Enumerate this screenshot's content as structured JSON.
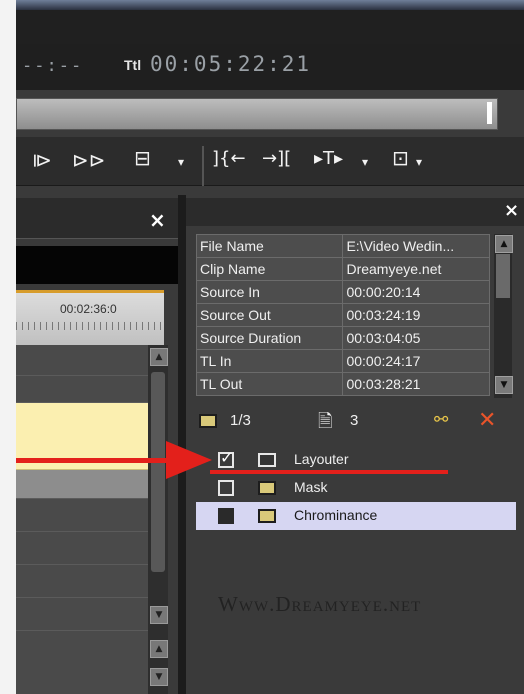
{
  "timecode": {
    "dashes": "--:--",
    "label": "Ttl",
    "value": "00:05:22:21"
  },
  "toolbar": {
    "icons": [
      {
        "name": "play-frame-icon",
        "glyph": "⧐"
      },
      {
        "name": "fast-forward-icon",
        "glyph": "⊳⊳"
      },
      {
        "name": "display-icon",
        "glyph": "⊟"
      },
      {
        "name": "mark-in-icon",
        "glyph": "]{←"
      },
      {
        "name": "mark-out-icon",
        "glyph": "→]["
      },
      {
        "name": "split-icon",
        "glyph": "▸T▸"
      },
      {
        "name": "export-icon",
        "glyph": "⊡"
      }
    ]
  },
  "left_panel": {
    "close": "×",
    "ruler_label": "00:02:36:0"
  },
  "right_panel": {
    "close": "×",
    "properties": [
      {
        "key": "File Name",
        "value": "E:\\Video Wedin..."
      },
      {
        "key": "Clip Name",
        "value": "Dreamyeye.net"
      },
      {
        "key": "Source In",
        "value": "00:00:20:14"
      },
      {
        "key": "Source Out",
        "value": "00:03:24:19"
      },
      {
        "key": "Source Duration",
        "value": "00:03:04:05"
      },
      {
        "key": "TL In",
        "value": "00:00:24:17"
      },
      {
        "key": "TL Out",
        "value": "00:03:28:21"
      }
    ],
    "fx_count": "1/3",
    "fx_total": "3",
    "effects": [
      {
        "label": "Layouter",
        "checked": true
      },
      {
        "label": "Mask",
        "checked": false
      },
      {
        "label": "Chrominance",
        "checked": false,
        "selected": true
      }
    ]
  },
  "watermark": "Www.Dreamyeye.net",
  "colors": {
    "accent_red": "#e3201b",
    "timeline_yellow": "#fbefb0",
    "selection": "#d6d6f2"
  }
}
